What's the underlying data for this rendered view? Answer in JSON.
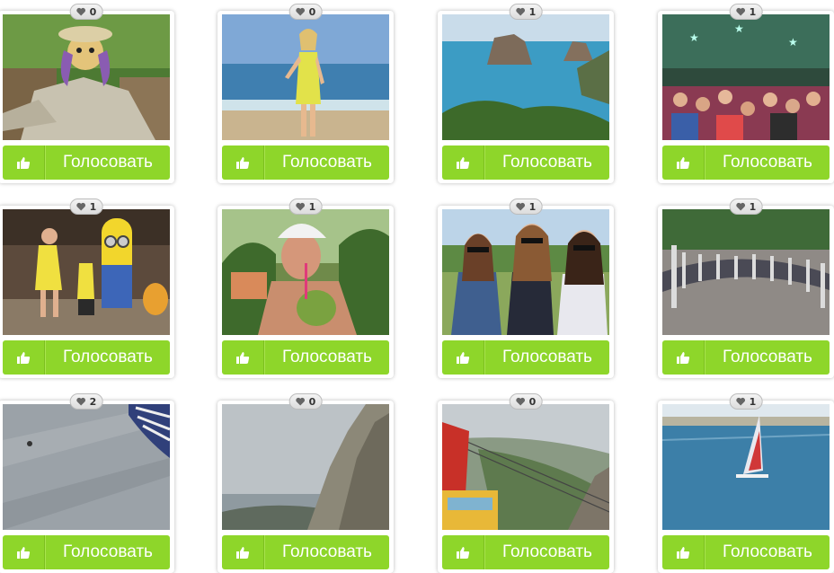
{
  "vote_label": "Голосовать",
  "colors": {
    "button": "#8ed62a",
    "button_text": "#ffffff",
    "badge": "#e6e6e6"
  },
  "icons": {
    "likes": "heart-icon",
    "vote": "thumbs-up-icon"
  },
  "cards": [
    {
      "likes": "0",
      "photo": "scarecrow-photo"
    },
    {
      "likes": "0",
      "photo": "girl-on-beach-photo"
    },
    {
      "likes": "1",
      "photo": "sea-rocks-photo"
    },
    {
      "likes": "1",
      "photo": "party-crowd-photo"
    },
    {
      "likes": "1",
      "photo": "minion-photo"
    },
    {
      "likes": "1",
      "photo": "man-with-coconut-photo"
    },
    {
      "likes": "1",
      "photo": "three-girls-photo"
    },
    {
      "likes": "1",
      "photo": "people-circle-photo"
    },
    {
      "likes": "2",
      "photo": "grey-surface-photo"
    },
    {
      "likes": "0",
      "photo": "mountain-cliff-photo"
    },
    {
      "likes": "0",
      "photo": "cable-car-photo"
    },
    {
      "likes": "1",
      "photo": "windsurfer-photo"
    }
  ]
}
